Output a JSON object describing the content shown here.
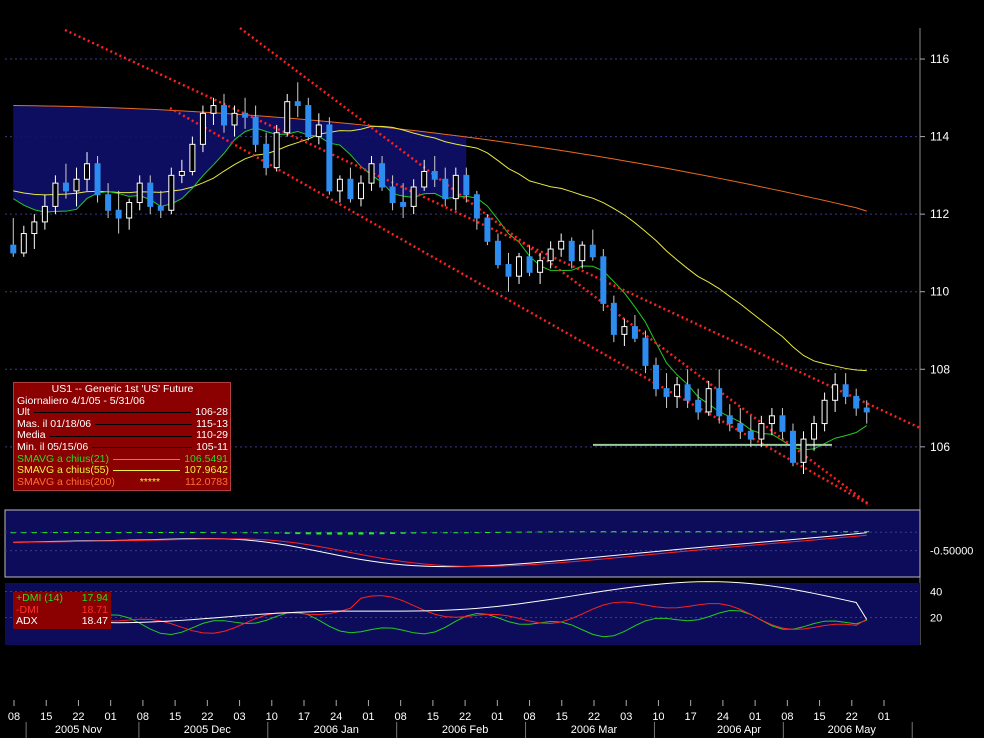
{
  "colors": {
    "background": "#000000",
    "panel": "#0c0c5a",
    "grid": "#3a3a8a",
    "candle_up": "#ffffff",
    "candle_down": "#2d8cf0",
    "sma21": "#22cc22",
    "sma55": "#e8e840",
    "sma200": "#e86a20",
    "channel": "#ff2020",
    "support": "#99cc99",
    "macd_hist": "#22ee22",
    "macd_line": "#ffffff",
    "signal_line": "#ff2020",
    "dmi_plus": "#22cc22",
    "dmi_minus": "#ff2020",
    "adx": "#ffffff"
  },
  "legend": {
    "title": "US1 -- Generic 1st 'US' Future",
    "subtitle": "Giornaliero 4/1/05 - 5/31/06",
    "rows": [
      {
        "label": "Ult",
        "value": "106-28",
        "color": "#ffffff"
      },
      {
        "label": "Mas. il  01/18/06",
        "value": "115-13",
        "color": "#ffffff"
      },
      {
        "label": "Media",
        "value": "110-29",
        "color": "#ffffff"
      },
      {
        "label": "Min. il  05/15/06",
        "value": "105-11",
        "color": "#ffffff"
      },
      {
        "label": "SMAVG a chius(21)",
        "value": "106.5491",
        "color": "#22dd22"
      },
      {
        "label": "SMAVG a chius(55)",
        "value": "107.9642",
        "color": "#f0f040"
      },
      {
        "label": "SMAVG a chius(200)",
        "value": "112.0783",
        "color": "#ff7030"
      }
    ],
    "marker": "*****"
  },
  "dmi_legend": {
    "rows": [
      {
        "label": "+DMI (14)",
        "value": "17.94",
        "color": "#22dd22"
      },
      {
        "label": "-DMI",
        "value": "18.71",
        "color": "#ff3030"
      },
      {
        "label": "ADX",
        "value": "18.47",
        "color": "#ffffff"
      }
    ]
  },
  "chart_data": [
    {
      "type": "candlestick",
      "title": "US1 -- Generic 1st 'US' Future",
      "y_ticks": [
        106,
        108,
        110,
        112,
        114,
        116
      ],
      "ylim": [
        104.5,
        116.8
      ],
      "x_tick_labels": [
        "08",
        "15",
        "22",
        "01",
        "08",
        "15",
        "22",
        "03",
        "10",
        "17",
        "24",
        "01",
        "08",
        "15",
        "22",
        "01",
        "08",
        "15",
        "22",
        "03",
        "10",
        "17",
        "24",
        "01",
        "08",
        "15",
        "22",
        "01"
      ],
      "x_month_labels": [
        {
          "label": "2005 Nov",
          "at": 2
        },
        {
          "label": "2005 Dec",
          "at": 6
        },
        {
          "label": "2006 Jan",
          "at": 10
        },
        {
          "label": "2006 Feb",
          "at": 14
        },
        {
          "label": "2006 Mar",
          "at": 18
        },
        {
          "label": "2006 Apr",
          "at": 22.5
        },
        {
          "label": "2006 May",
          "at": 26
        }
      ],
      "candles": [
        [
          111.2,
          111.9,
          110.9,
          111.0
        ],
        [
          111.0,
          111.7,
          110.9,
          111.5
        ],
        [
          111.5,
          112.0,
          111.1,
          111.8
        ],
        [
          111.8,
          112.5,
          111.6,
          112.2
        ],
        [
          112.2,
          113.0,
          112.0,
          112.8
        ],
        [
          112.8,
          113.3,
          112.4,
          112.6
        ],
        [
          112.6,
          113.2,
          112.2,
          112.9
        ],
        [
          112.9,
          113.6,
          112.6,
          113.3
        ],
        [
          113.3,
          113.5,
          112.3,
          112.5
        ],
        [
          112.5,
          112.8,
          111.9,
          112.1
        ],
        [
          112.1,
          112.6,
          111.5,
          111.9
        ],
        [
          111.9,
          112.4,
          111.6,
          112.3
        ],
        [
          112.3,
          113.0,
          112.1,
          112.8
        ],
        [
          112.8,
          113.0,
          112.0,
          112.2
        ],
        [
          112.2,
          112.6,
          111.9,
          112.1
        ],
        [
          112.1,
          113.2,
          112.0,
          113.0
        ],
        [
          113.0,
          113.4,
          112.8,
          113.1
        ],
        [
          113.1,
          114.0,
          113.0,
          113.8
        ],
        [
          113.8,
          114.8,
          113.6,
          114.6
        ],
        [
          114.6,
          115.0,
          114.3,
          114.8
        ],
        [
          114.8,
          115.1,
          114.1,
          114.3
        ],
        [
          114.3,
          114.8,
          114.0,
          114.6
        ],
        [
          114.6,
          115.0,
          114.2,
          114.5
        ],
        [
          114.5,
          114.8,
          113.6,
          113.8
        ],
        [
          113.8,
          114.1,
          113.0,
          113.2
        ],
        [
          113.2,
          114.3,
          113.1,
          114.1
        ],
        [
          114.1,
          115.1,
          114.0,
          114.9
        ],
        [
          114.9,
          115.4,
          114.5,
          114.8
        ],
        [
          114.8,
          115.0,
          113.9,
          114.0
        ],
        [
          114.0,
          114.6,
          113.8,
          114.3
        ],
        [
          114.3,
          114.5,
          112.5,
          112.6
        ],
        [
          112.6,
          113.0,
          112.3,
          112.9
        ],
        [
          112.9,
          113.2,
          112.3,
          112.4
        ],
        [
          112.4,
          113.0,
          112.2,
          112.8
        ],
        [
          112.8,
          113.5,
          112.6,
          113.3
        ],
        [
          113.3,
          113.5,
          112.6,
          112.7
        ],
        [
          112.7,
          113.0,
          112.1,
          112.3
        ],
        [
          112.3,
          112.8,
          111.9,
          112.2
        ],
        [
          112.2,
          112.9,
          112.0,
          112.7
        ],
        [
          112.7,
          113.4,
          112.6,
          113.1
        ],
        [
          113.1,
          113.5,
          112.7,
          112.9
        ],
        [
          112.9,
          113.2,
          112.2,
          112.4
        ],
        [
          112.4,
          113.2,
          112.1,
          113.0
        ],
        [
          113.0,
          113.2,
          112.3,
          112.5
        ],
        [
          112.5,
          112.6,
          111.6,
          111.9
        ],
        [
          111.9,
          112.0,
          111.2,
          111.3
        ],
        [
          111.3,
          111.5,
          110.6,
          110.7
        ],
        [
          110.7,
          111.0,
          110.0,
          110.4
        ],
        [
          110.4,
          111.0,
          110.2,
          110.9
        ],
        [
          110.9,
          111.2,
          110.4,
          110.5
        ],
        [
          110.5,
          111.0,
          110.2,
          110.8
        ],
        [
          110.8,
          111.3,
          110.6,
          111.1
        ],
        [
          111.1,
          111.5,
          110.9,
          111.3
        ],
        [
          111.3,
          111.4,
          110.6,
          110.8
        ],
        [
          110.8,
          111.3,
          110.6,
          111.2
        ],
        [
          111.2,
          111.6,
          110.8,
          110.9
        ],
        [
          110.9,
          111.1,
          109.5,
          109.7
        ],
        [
          109.7,
          109.9,
          108.7,
          108.9
        ],
        [
          108.9,
          109.3,
          108.6,
          109.1
        ],
        [
          109.1,
          109.4,
          108.7,
          108.8
        ],
        [
          108.8,
          109.0,
          107.9,
          108.1
        ],
        [
          108.1,
          108.3,
          107.3,
          107.5
        ],
        [
          107.5,
          107.9,
          107.0,
          107.3
        ],
        [
          107.3,
          107.8,
          107.0,
          107.6
        ],
        [
          107.6,
          108.0,
          107.0,
          107.2
        ],
        [
          107.2,
          107.5,
          106.7,
          106.9
        ],
        [
          106.9,
          107.7,
          106.8,
          107.5
        ],
        [
          107.5,
          108.0,
          106.6,
          106.8
        ],
        [
          106.8,
          107.1,
          106.4,
          106.6
        ],
        [
          106.6,
          107.0,
          106.2,
          106.4
        ],
        [
          106.4,
          106.8,
          106.0,
          106.2
        ],
        [
          106.2,
          106.8,
          106.0,
          106.6
        ],
        [
          106.6,
          107.0,
          106.3,
          106.8
        ],
        [
          106.8,
          107.0,
          106.2,
          106.4
        ],
        [
          106.4,
          106.6,
          105.5,
          105.6
        ],
        [
          105.6,
          106.4,
          105.3,
          106.2
        ],
        [
          106.2,
          106.8,
          105.9,
          106.6
        ],
        [
          106.6,
          107.4,
          106.4,
          107.2
        ],
        [
          107.2,
          107.9,
          106.9,
          107.6
        ],
        [
          107.6,
          107.9,
          107.1,
          107.3
        ],
        [
          107.3,
          107.5,
          106.8,
          107.0
        ],
        [
          107.0,
          107.2,
          106.6,
          106.9
        ]
      ],
      "sma21_start": 112.4,
      "sma21_end": 106.5491,
      "sma55_end": 107.9642,
      "sma200_end": 112.0783,
      "support_level": 106.05
    },
    {
      "type": "macd",
      "y_ticks": [
        -0.5
      ],
      "y_tick_labels": [
        "-0.50000"
      ]
    },
    {
      "type": "dmi",
      "y_ticks": [
        20,
        40
      ],
      "y_tick_labels": [
        "20",
        "40"
      ],
      "series": [
        {
          "name": "+DMI (14)",
          "last": 17.94
        },
        {
          "name": "-DMI",
          "last": 18.71
        },
        {
          "name": "ADX",
          "last": 18.47
        }
      ]
    }
  ]
}
